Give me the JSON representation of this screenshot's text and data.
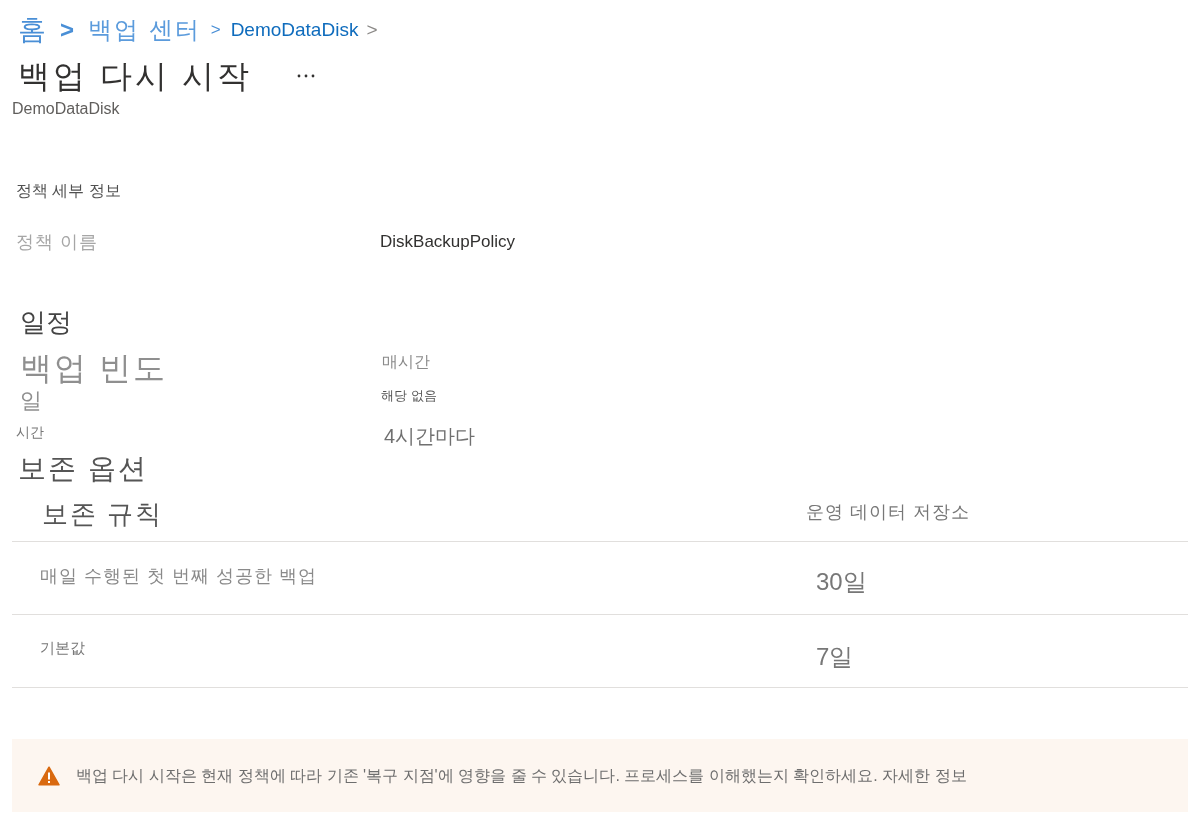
{
  "breadcrumb": [
    {
      "label": "홈",
      "separator": ">"
    },
    {
      "label": "백업 센터",
      "separator": ">"
    },
    {
      "label": "DemoDataDisk",
      "separator": ">"
    }
  ],
  "page": {
    "title": "백업 다시 시작",
    "subtitle": "DemoDataDisk"
  },
  "policy_details": {
    "heading": "정책 세부 정보",
    "fields": [
      {
        "label": "정책 이름",
        "value": "DiskBackupPolicy"
      }
    ]
  },
  "schedule": {
    "heading": "일정",
    "fields": [
      {
        "label": "백업 빈도",
        "value": "매시간"
      },
      {
        "label": "일",
        "value": "해당 없음"
      },
      {
        "label": "시간",
        "value": "4시간마다"
      }
    ]
  },
  "retention": {
    "heading": "보존 옵션",
    "table": {
      "columns": [
        "보존 규칙",
        "운영 데이터 저장소"
      ],
      "rows": [
        [
          "매일 수행된 첫 번째 성공한 백업",
          "30일"
        ],
        [
          "기본값",
          "7일"
        ]
      ]
    }
  },
  "warning": {
    "text": "백업 다시 시작은 현재 정책에 따라 기존 '복구 지점'에 영향을 줄 수 있습니다. 프로세스를 이해했는지 확인하세요. 자세한 정보"
  }
}
